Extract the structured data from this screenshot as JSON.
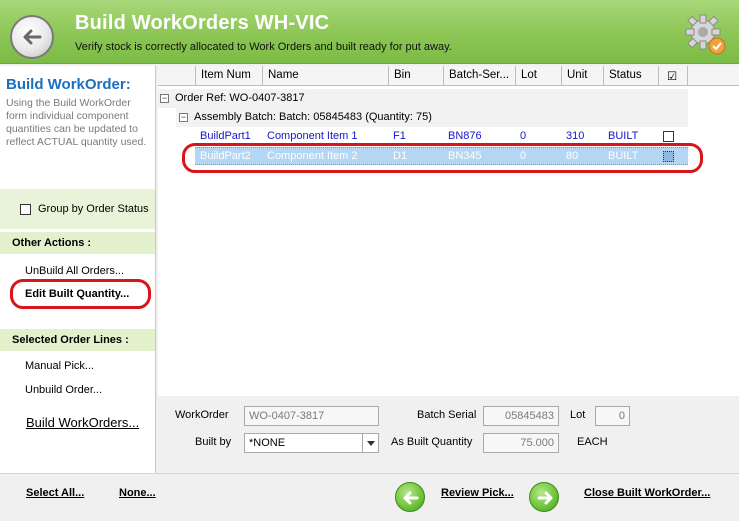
{
  "header": {
    "title": "Build WorkOrders WH-VIC",
    "subtitle": "Verify stock is correctly allocated to Work Orders and built ready for put away."
  },
  "left": {
    "title": "Build WorkOrder:",
    "description": "Using the Build WorkOrder form individual component quantities can be updated to reflect ACTUAL quantity used.",
    "group_by_label": "Group by Order Status",
    "other_actions_header": "Other Actions :",
    "unbuild_all": "UnBuild All Orders...",
    "edit_built_qty": "Edit Built Quantity...",
    "selected_lines_header": "Selected Order Lines :",
    "manual_pick": "Manual Pick...",
    "unbuild_order": "Unbuild Order...",
    "build_workorders": "Build WorkOrders..."
  },
  "grid": {
    "columns": [
      "Item Num",
      "Name",
      "Bin",
      "Batch-Ser...",
      "Lot",
      "Unit",
      "Status",
      "☑"
    ],
    "order_ref": "Order Ref: WO-0407-3817",
    "assembly_batch": "Assembly Batch: Batch: 05845483 (Quantity: 75)",
    "rows": [
      {
        "item": "BuildPart1",
        "name": "Component Item 1",
        "bin": "F1",
        "batch": "BN876",
        "lot": "0",
        "unit": "310",
        "status": "BUILT"
      },
      {
        "item": "BuildPart2",
        "name": "Component Item 2",
        "bin": "D1",
        "batch": "BN345",
        "lot": "0",
        "unit": "80",
        "status": "BUILT"
      }
    ]
  },
  "form": {
    "workorder_label": "WorkOrder",
    "workorder_value": "WO-0407-3817",
    "batch_serial_label": "Batch Serial",
    "batch_serial_value": "05845483",
    "lot_label": "Lot",
    "lot_value": "0",
    "built_by_label": "Built by",
    "built_by_value": "*NONE",
    "as_built_qty_label": "As Built Quantity",
    "as_built_qty_value": "75.000",
    "unit_label": "EACH"
  },
  "footer": {
    "select_all": "Select All...",
    "none": "None...",
    "review_pick": "Review Pick...",
    "close_built": "Close Built WorkOrder..."
  },
  "colors": {
    "header_green": "#8cc655",
    "title_blue": "#1b6fc1",
    "row_link_blue": "#1515c8",
    "selected_row": "#b4d6f2",
    "highlight_red": "#d9141a"
  },
  "icons": {
    "back": "back-arrow-icon",
    "gear": "settings-gear-icon",
    "review": "left-arrow-icon",
    "close": "right-arrow-icon"
  }
}
